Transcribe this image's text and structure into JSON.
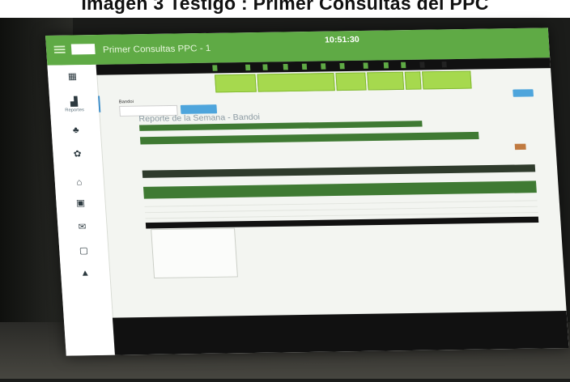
{
  "caption": "Imagen 3 Testigo : Primer Consultas del PPC",
  "topbar": {
    "title": "Primer Consultas PPC - 1",
    "time": "10:51:30",
    "date": "",
    "logo": "",
    "user_links": [
      "",
      ""
    ]
  },
  "sidebar": {
    "items": [
      {
        "icon": "calendar-icon",
        "glyph": "▦",
        "label": ""
      },
      {
        "icon": "chart-icon",
        "glyph": "▟",
        "label": "Reportes"
      },
      {
        "icon": "users-icon",
        "glyph": "♣",
        "label": ""
      },
      {
        "icon": "settings-icon",
        "glyph": "✿",
        "label": ""
      },
      {
        "icon": "home-icon",
        "glyph": "⌂",
        "label": ""
      },
      {
        "icon": "briefcase-icon",
        "glyph": "▣",
        "label": ""
      },
      {
        "icon": "mail-icon",
        "glyph": "✉",
        "label": ""
      },
      {
        "icon": "document-icon",
        "glyph": "▢",
        "label": ""
      },
      {
        "icon": "person-icon",
        "glyph": "▲",
        "label": ""
      }
    ]
  },
  "navbar": {
    "items": [
      "",
      "",
      "",
      "",
      "",
      "",
      "",
      "",
      "",
      "",
      "",
      ""
    ]
  },
  "tiles": [
    "",
    "",
    "",
    "",
    "",
    ""
  ],
  "filter": {
    "label": "Bandoi",
    "select_value": "",
    "button_label": ""
  },
  "right_button_label": "",
  "report": {
    "title": "Reporte de la Semana - Bandoi",
    "panel_header": "",
    "info_lines": [
      "",
      "",
      "",
      "",
      "",
      ""
    ],
    "table_headers": [
      "",
      "",
      ""
    ],
    "band_columns": [
      "",
      "",
      "",
      ""
    ],
    "rows": [
      {
        "c1": "",
        "c2": "",
        "c3": ""
      },
      {
        "c1": "",
        "c2": "",
        "c3": ""
      },
      {
        "c1": "",
        "c2": "",
        "c3": ""
      },
      {
        "c1": "",
        "c2": "",
        "c3": ""
      }
    ],
    "sub_lines": [
      "",
      "",
      "",
      "",
      "",
      "",
      ""
    ]
  },
  "footer": {
    "left": "",
    "right": ""
  },
  "colors": {
    "primary_green": "#5faa45",
    "tile_green": "#a6d94e",
    "dark_green": "#3f7a33",
    "accent_blue": "#4ea5dc"
  }
}
